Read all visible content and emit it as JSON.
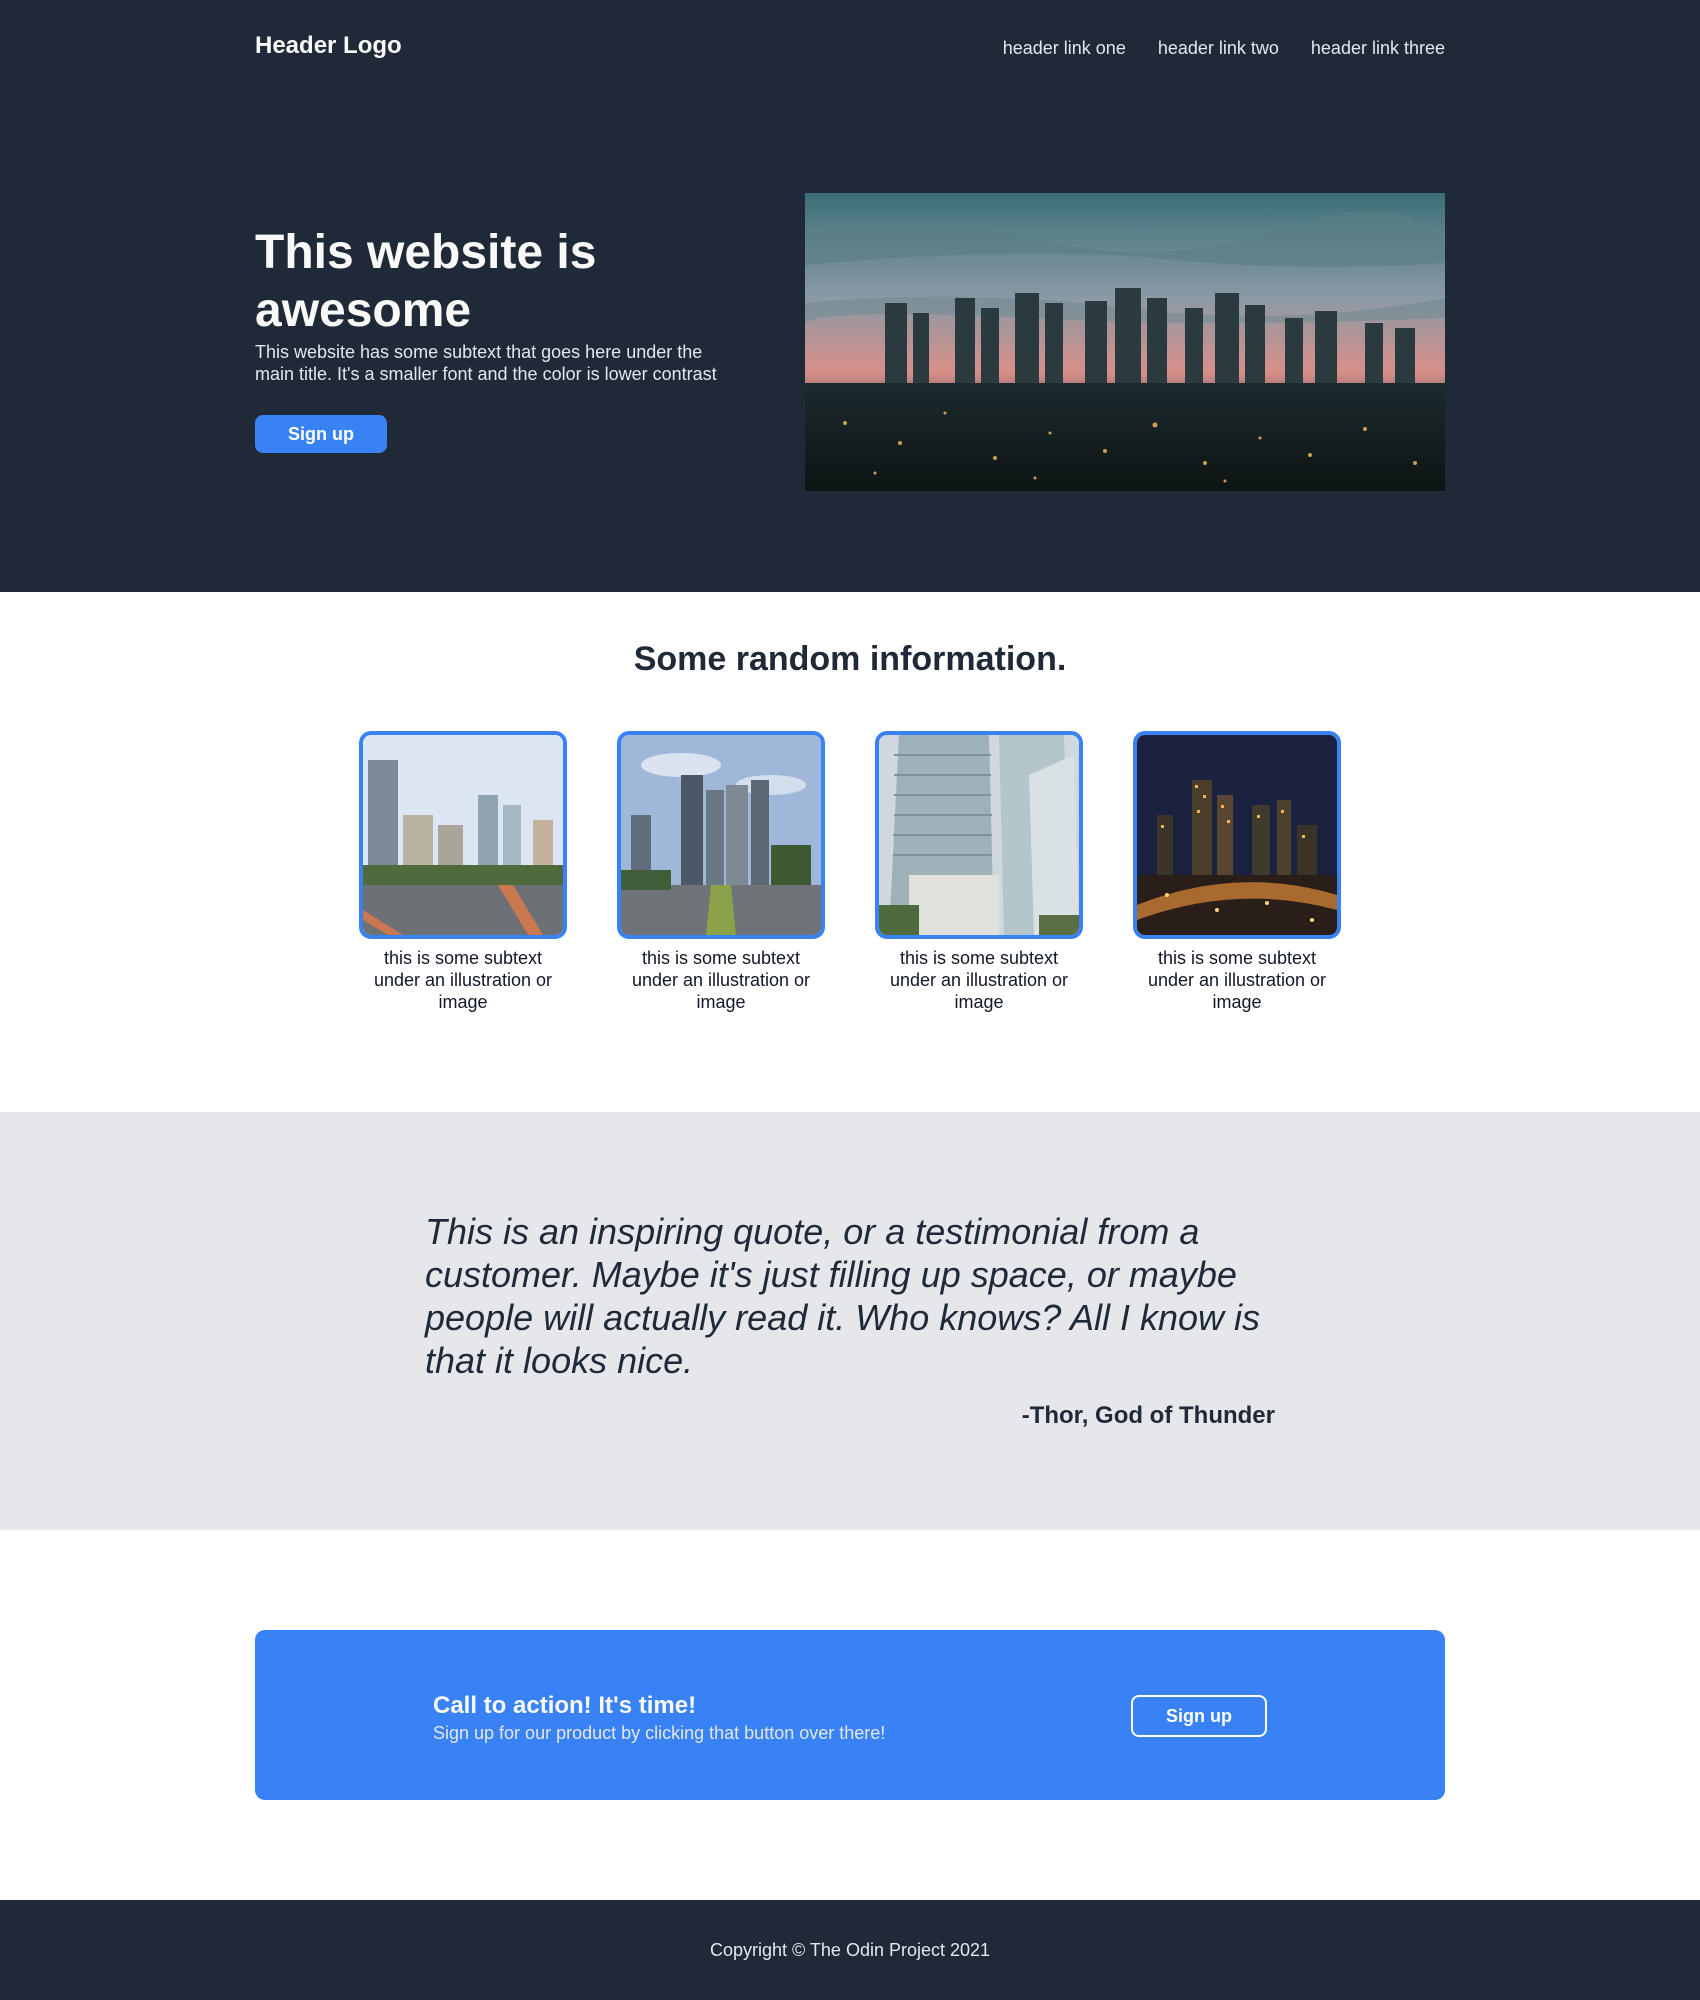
{
  "header": {
    "logo": "Header Logo",
    "links": [
      "header link one",
      "header link two",
      "header link three"
    ]
  },
  "hero": {
    "title": "This website is awesome",
    "subtext": "This website has some subtext that goes here under the main title. It's a smaller font and the color is lower contrast",
    "button": "Sign up"
  },
  "info": {
    "title": "Some random information.",
    "cards": [
      {
        "text": "this is some subtext under an illustration or image"
      },
      {
        "text": "this is some subtext under an illustration or image"
      },
      {
        "text": "this is some subtext under an illustration or image"
      },
      {
        "text": "this is some subtext under an illustration or image"
      }
    ]
  },
  "quote": {
    "text": "This is an inspiring quote, or a testimonial from a customer. Maybe it's just filling up space, or maybe people will actually read it. Who knows? All I know is that it looks nice.",
    "author": "-Thor, God of Thunder"
  },
  "cta": {
    "title": "Call to action! It's time!",
    "subtext": "Sign up for our product by clicking that button over there!",
    "button": "Sign up"
  },
  "footer": {
    "copyright": "Copyright © The Odin Project 2021"
  },
  "colors": {
    "dark": "#1f2937",
    "accent": "#3882f6",
    "light_gray": "#e5e7eb",
    "white": "#ffffff"
  }
}
